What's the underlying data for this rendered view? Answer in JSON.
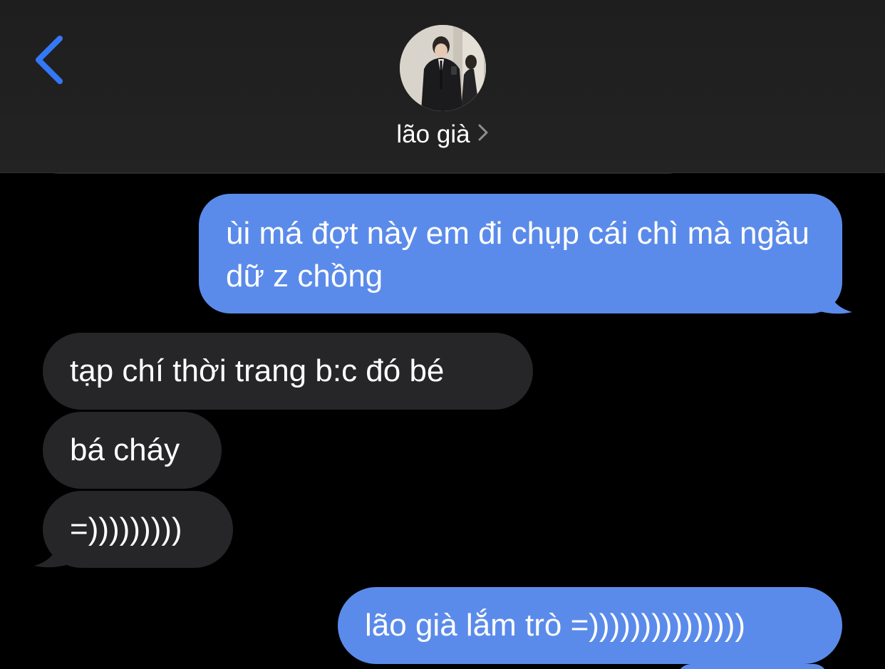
{
  "header": {
    "contact_name": "lão già",
    "back_icon": "chevron-left-icon",
    "disclosure_icon": "chevron-right-icon",
    "accent_color": "#3478f6"
  },
  "messages": [
    {
      "direction": "sent",
      "text": "ùi má đợt này em đi chụp cái chì mà ngầu dữ z chồng"
    },
    {
      "direction": "received",
      "text": "tạp chí thời trang b:c đó bé"
    },
    {
      "direction": "received",
      "text": "bá cháy"
    },
    {
      "direction": "received",
      "text": "=)))))))))"
    },
    {
      "direction": "sent",
      "text": "lão già lắm trò =)))))))))))))))"
    }
  ],
  "colors": {
    "sent_bubble": "#5b8bea",
    "received_bubble": "#262628",
    "background": "#000000",
    "text": "#ffffff"
  }
}
